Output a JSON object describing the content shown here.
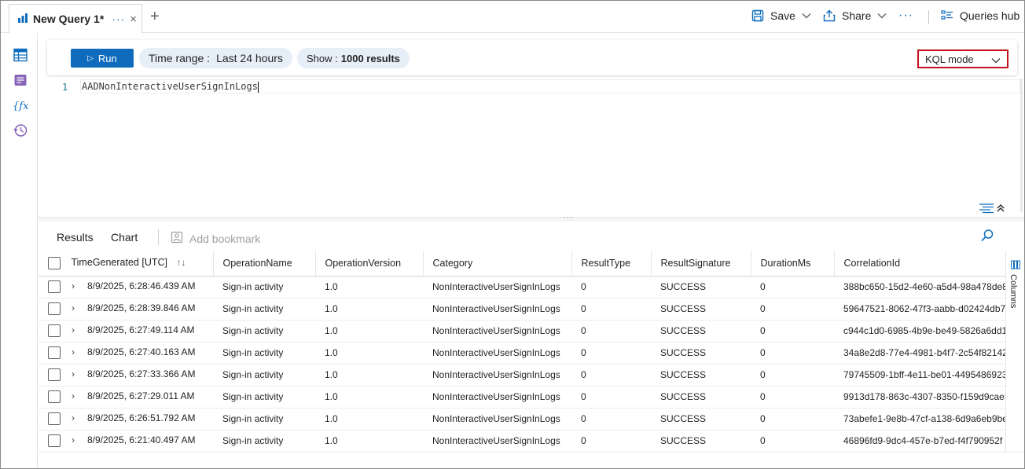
{
  "tab": {
    "title": "New Query 1*",
    "more": "···",
    "close": "×",
    "add": "+"
  },
  "toolbar_top": {
    "save_label": "Save",
    "share_label": "Share",
    "more": "···",
    "queries_hub_label": "Queries hub"
  },
  "query_toolbar": {
    "run_label": "Run",
    "time_range_label": "Time range :",
    "time_range_value": "Last 24 hours",
    "show_label": "Show :",
    "show_value": "1000 results",
    "mode_label": "KQL mode"
  },
  "editor": {
    "line_number": "1",
    "code": "AADNonInteractiveUserSignInLogs"
  },
  "results_tabs": {
    "results": "Results",
    "chart": "Chart",
    "add_bookmark": "Add bookmark"
  },
  "grid": {
    "columns": [
      "TimeGenerated [UTC]",
      "OperationName",
      "OperationVersion",
      "Category",
      "ResultType",
      "ResultSignature",
      "DurationMs",
      "CorrelationId"
    ],
    "rows": [
      [
        "8/9/2025, 6:28:46.439 AM",
        "Sign-in activity",
        "1.0",
        "NonInteractiveUserSignInLogs",
        "0",
        "SUCCESS",
        "0",
        "388bc650-15d2-4e60-a5d4-98a478de8"
      ],
      [
        "8/9/2025, 6:28:39.846 AM",
        "Sign-in activity",
        "1.0",
        "NonInteractiveUserSignInLogs",
        "0",
        "SUCCESS",
        "0",
        "59647521-8062-47f3-aabb-d02424db7"
      ],
      [
        "8/9/2025, 6:27:49.114 AM",
        "Sign-in activity",
        "1.0",
        "NonInteractiveUserSignInLogs",
        "0",
        "SUCCESS",
        "0",
        "c944c1d0-6985-4b9e-be49-5826a6dd1"
      ],
      [
        "8/9/2025, 6:27:40.163 AM",
        "Sign-in activity",
        "1.0",
        "NonInteractiveUserSignInLogs",
        "0",
        "SUCCESS",
        "0",
        "34a8e2d8-77e4-4981-b4f7-2c54f82142"
      ],
      [
        "8/9/2025, 6:27:33.366 AM",
        "Sign-in activity",
        "1.0",
        "NonInteractiveUserSignInLogs",
        "0",
        "SUCCESS",
        "0",
        "79745509-1bff-4e11-be01-4495486923"
      ],
      [
        "8/9/2025, 6:27:29.011 AM",
        "Sign-in activity",
        "1.0",
        "NonInteractiveUserSignInLogs",
        "0",
        "SUCCESS",
        "0",
        "9913d178-863c-4307-8350-f159d9cae3"
      ],
      [
        "8/9/2025, 6:26:51.792 AM",
        "Sign-in activity",
        "1.0",
        "NonInteractiveUserSignInLogs",
        "0",
        "SUCCESS",
        "0",
        "73abefe1-9e8b-47cf-a138-6d9a6eb9be"
      ],
      [
        "8/9/2025, 6:21:40.497 AM",
        "Sign-in activity",
        "1.0",
        "NonInteractiveUserSignInLogs",
        "0",
        "SUCCESS",
        "0",
        "46896fd9-9dc4-457e-b7ed-f4f790952f"
      ]
    ]
  },
  "side_panel": {
    "columns_label": "Columns"
  },
  "icons": {
    "tab": "query-icon",
    "save": "save-icon",
    "share": "share-icon",
    "queries_hub": "queries-hub-icon",
    "rail": [
      "tables-icon",
      "queries-icon",
      "functions-icon",
      "history-icon"
    ],
    "search": "search-icon",
    "bookmark": "bookmark-icon"
  },
  "colors": {
    "accent": "#0f6cbd",
    "highlight_border": "#c50f1f",
    "pill_bg": "#e6eef7"
  }
}
